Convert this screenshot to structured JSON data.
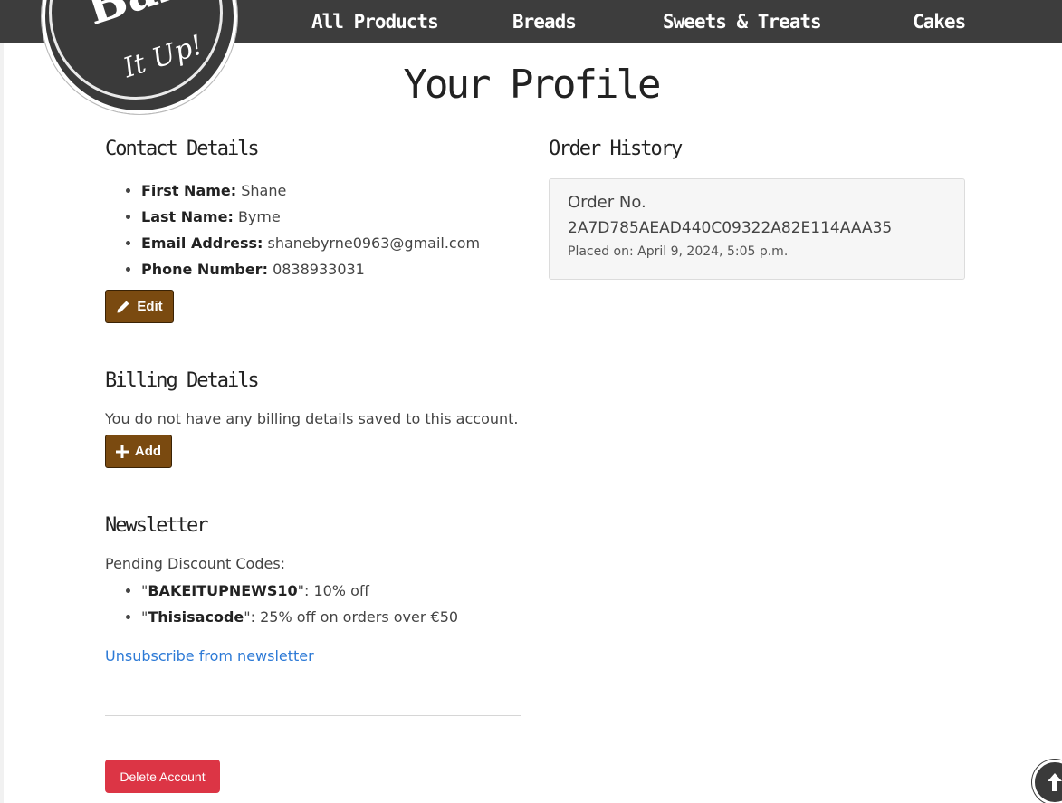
{
  "logo": {
    "line1": "Bake",
    "line2": "It Up!"
  },
  "nav": {
    "items": [
      "All Products",
      "Breads",
      "Sweets & Treats",
      "Cakes"
    ]
  },
  "page": {
    "title": "Your Profile"
  },
  "contact": {
    "heading": "Contact Details",
    "first_name_label": "First Name:",
    "first_name": "Shane",
    "last_name_label": "Last Name:",
    "last_name": "Byrne",
    "email_label": "Email Address:",
    "email": "shanebyrne0963@gmail.com",
    "phone_label": "Phone Number:",
    "phone": "0838933031",
    "edit_label": "Edit"
  },
  "billing": {
    "heading": "Billing Details",
    "empty_text": "You do not have any billing details saved to this account.",
    "add_label": "Add"
  },
  "newsletter": {
    "heading": "Newsletter",
    "pending_label": "Pending Discount Codes:",
    "codes": [
      {
        "code": "BAKEITUPNEWS10",
        "desc": ": 10% off"
      },
      {
        "code": "Thisisacode",
        "desc": ": 25% off on orders over €50"
      }
    ],
    "unsubscribe_label": "Unsubscribe from newsletter"
  },
  "account": {
    "delete_label": "Delete Account"
  },
  "orders": {
    "heading": "Order History",
    "order_label": "Order No.",
    "order_number": "2A7D785AEAD440C09322A82E114AAA35",
    "placed_on": "Placed on: April 9, 2024, 5:05 p.m."
  },
  "colors": {
    "navbar": "#3d3d3d",
    "brand_button": "#7a4a10",
    "danger": "#dc3545",
    "link": "#2d7ad6"
  },
  "icons": {
    "edit": "pencil-icon",
    "add": "plus-icon",
    "scroll_top": "arrow-up-icon"
  }
}
